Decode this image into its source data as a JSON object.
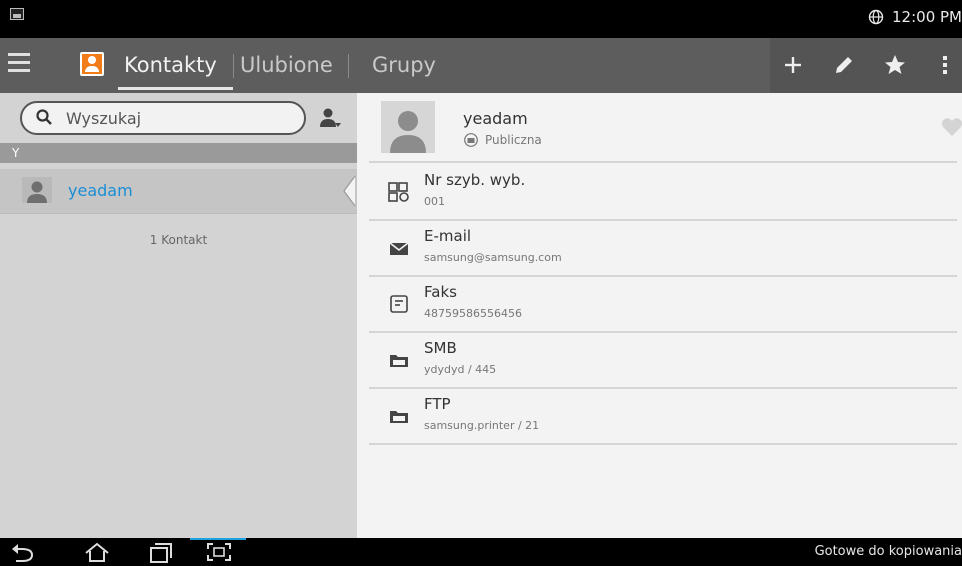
{
  "status_bar": {
    "time": "12:00 PM",
    "icons": [
      "image-icon",
      "globe-icon"
    ]
  },
  "action_bar": {
    "tabs": [
      {
        "label": "Kontakty",
        "selected": true
      },
      {
        "label": "Ulubione",
        "selected": false
      },
      {
        "label": "Grupy",
        "selected": false
      }
    ],
    "actions": [
      "add-icon",
      "edit-icon",
      "star-icon",
      "overflow-menu-icon"
    ],
    "colors": {
      "bar": "#5d5d5d",
      "contact_icon": "#f07c1a"
    }
  },
  "left_panel": {
    "search": {
      "placeholder": "Wyszukaj",
      "value": ""
    },
    "section_letter": "Y",
    "contacts": [
      {
        "name": "yeadam"
      }
    ],
    "count": "1 Kontakt",
    "colors": {
      "contact_name": "#1a8fd6"
    }
  },
  "detail": {
    "name": "yeadam",
    "visibility": "Publiczna",
    "fields": [
      {
        "label": "Nr szyb. wyb.",
        "value": "001",
        "icon": "speed-dial-icon"
      },
      {
        "label": "E-mail",
        "value": "samsung@samsung.com",
        "icon": "mail-icon"
      },
      {
        "label": "Faks",
        "value": "48759586556456",
        "icon": "fax-icon"
      },
      {
        "label": "SMB",
        "value": "ydydyd / 445",
        "icon": "smb-folder-icon"
      },
      {
        "label": "FTP",
        "value": "samsung.printer / 21",
        "icon": "ftp-folder-icon"
      }
    ]
  },
  "nav_bar": {
    "buttons": [
      "back-icon",
      "home-icon",
      "recent-apps-icon",
      "screen-capture-icon"
    ],
    "status": "Gotowe do kopiowania"
  }
}
